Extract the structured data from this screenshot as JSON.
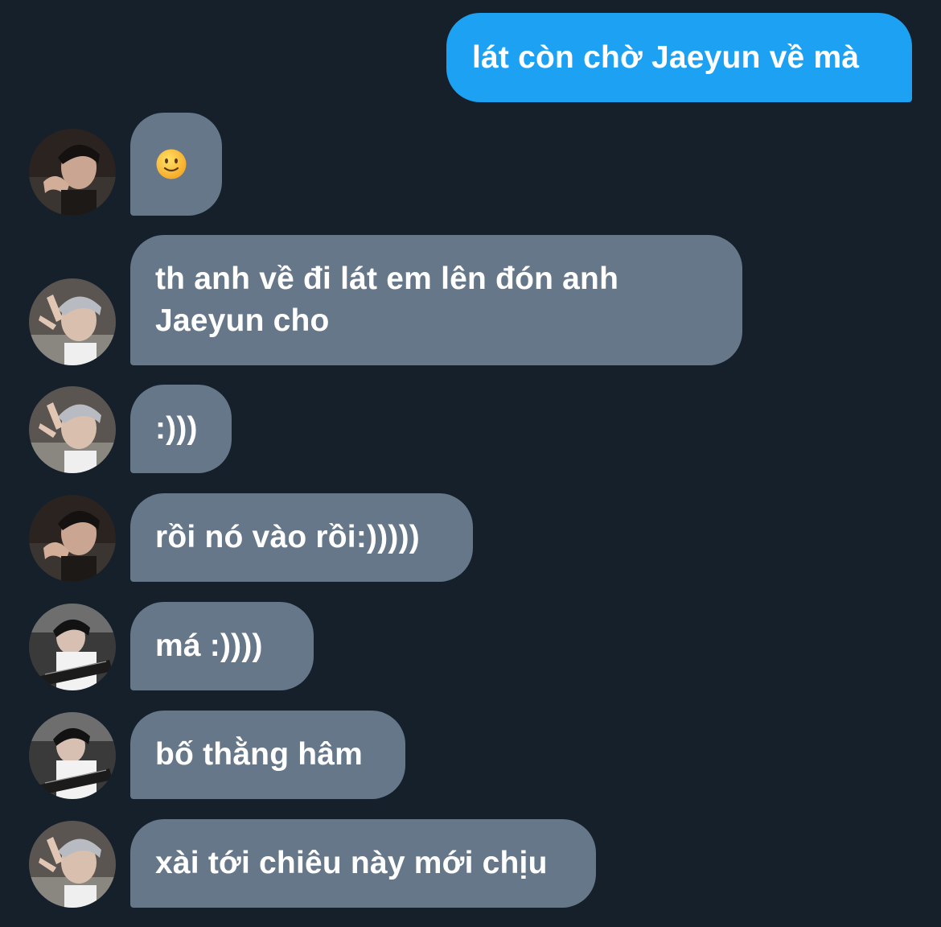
{
  "conversation": {
    "sent": [
      {
        "text": "lát còn chờ Jaeyun về mà"
      }
    ],
    "received": [
      {
        "text": "",
        "emoji": "slightly-smiling-face-emoji",
        "avatar": "avatar-a"
      },
      {
        "text": "th anh về đi lát em lên đón anh Jaeyun cho",
        "avatar": "avatar-b"
      },
      {
        "text": ":)))",
        "avatar": "avatar-b"
      },
      {
        "text": "rồi nó vào rồi:)))))",
        "avatar": "avatar-a"
      },
      {
        "text": "má :))))",
        "avatar": "avatar-c"
      },
      {
        "text": "bố thằng hâm",
        "avatar": "avatar-c"
      },
      {
        "text": "xài tới chiêu này mới chịu",
        "avatar": "avatar-b"
      }
    ]
  },
  "colors": {
    "background": "#15202b",
    "sent_bubble": "#1da1f2",
    "received_bubble": "#66778a",
    "text": "#ffffff"
  }
}
